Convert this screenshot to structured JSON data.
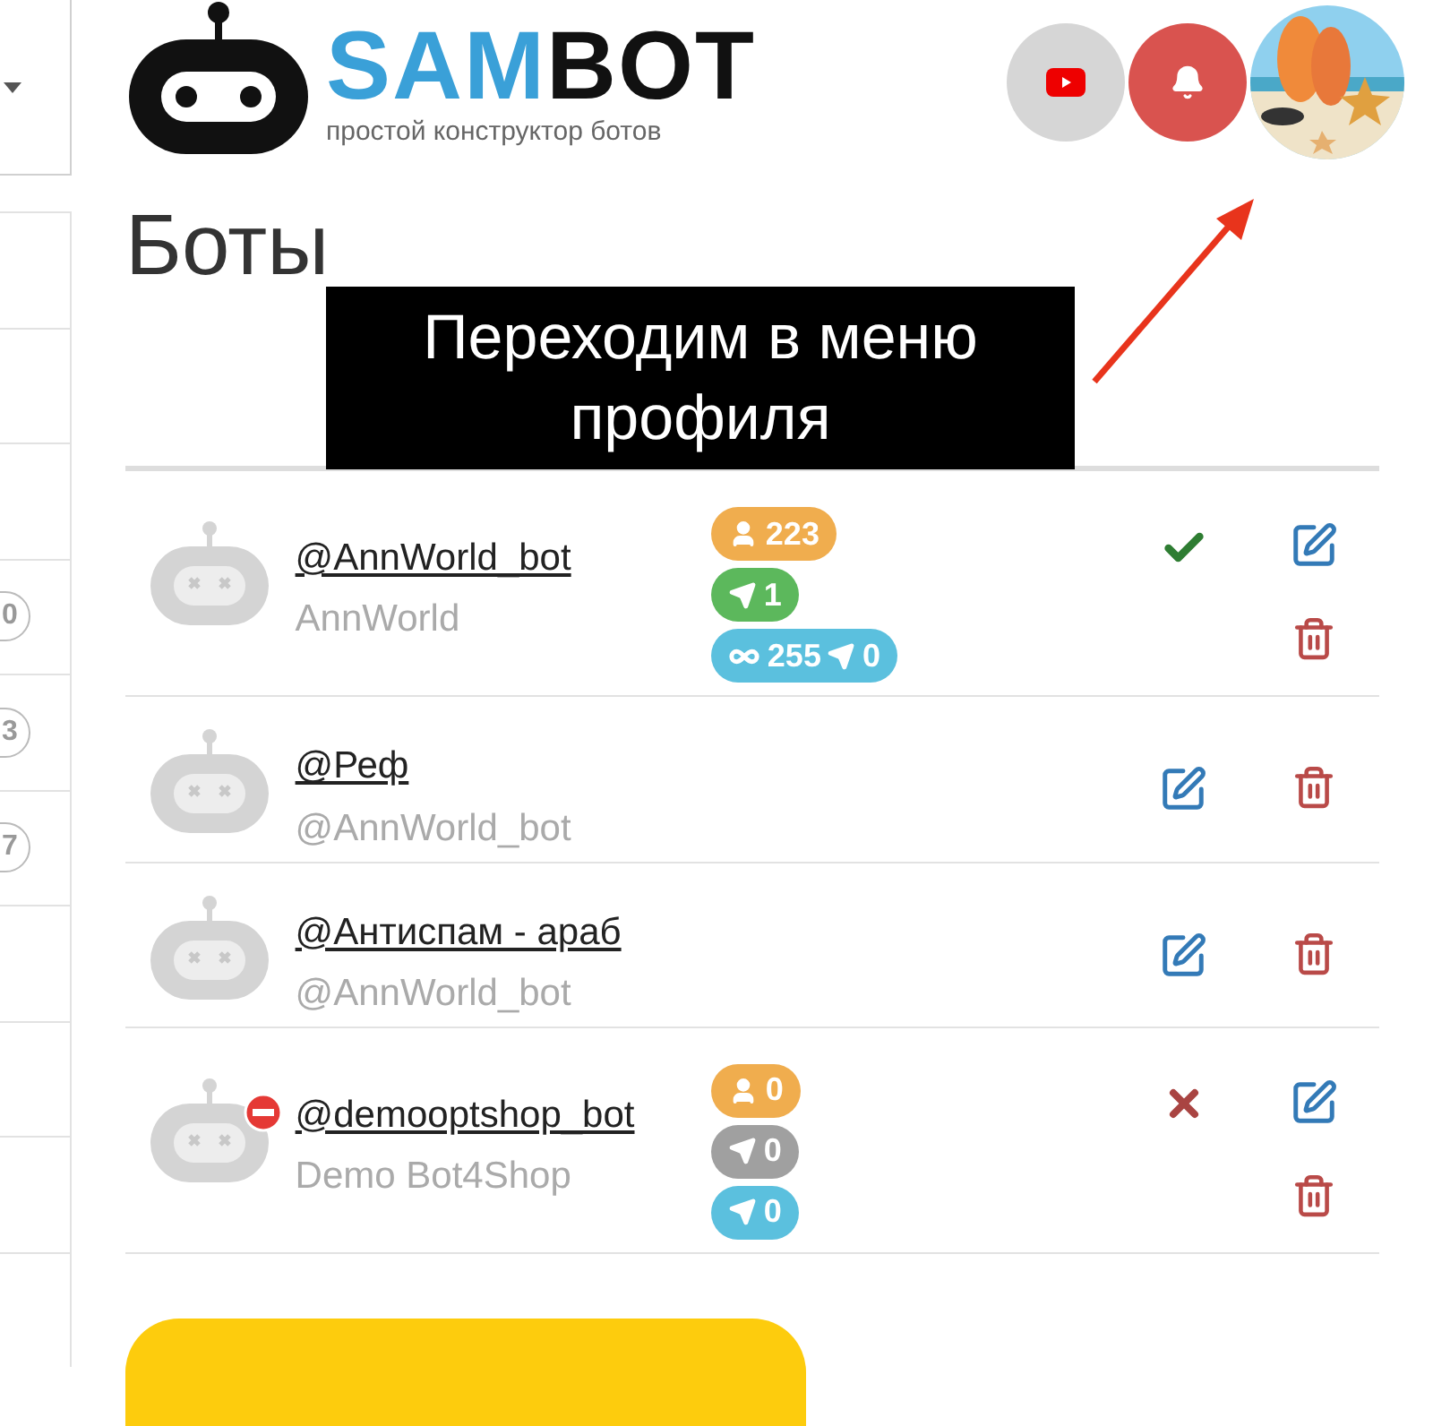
{
  "logo": {
    "brand_part_1": "SAM",
    "brand_part_2": "BOT",
    "tagline": "простой конструктор ботов"
  },
  "header_buttons": [
    {
      "kind": "youtube"
    },
    {
      "kind": "bell"
    }
  ],
  "sidebar": {
    "rows": [
      {},
      {},
      {},
      {
        "badge": "0"
      },
      {
        "badge": "3"
      },
      {
        "badge": "7"
      },
      {},
      {},
      {},
      {}
    ]
  },
  "page_title": "Боты",
  "callout": {
    "text": "Переходим в меню профиля"
  },
  "bots": [
    {
      "name": "@AnnWorld_bot",
      "subtitle": "AnnWorld",
      "blocked": false,
      "kind": "running",
      "badges": [
        {
          "color": "#f0ad4e",
          "parts": [
            {
              "kind": "users",
              "text": "223"
            }
          ]
        },
        {
          "color": "#5cb85c",
          "parts": [
            {
              "kind": "sent",
              "text": "1"
            }
          ]
        },
        {
          "color": "#5bc0de",
          "parts": [
            {
              "kind": "unlimited",
              "text": "255"
            },
            {
              "kind": "sent",
              "text": "0"
            }
          ]
        }
      ]
    },
    {
      "name": "@Реф",
      "subtitle": "@AnnWorld_bot",
      "blocked": false,
      "kind": "plain"
    },
    {
      "name": "@Антиспам - араб",
      "subtitle": "@AnnWorld_bot",
      "blocked": false,
      "kind": "plain"
    },
    {
      "name": "@demooptshop_bot",
      "subtitle": "Demo Bot4Shop",
      "blocked": true,
      "kind": "stopped",
      "badges": [
        {
          "color": "#f0ad4e",
          "parts": [
            {
              "kind": "users",
              "text": "0"
            }
          ]
        },
        {
          "color": "#a0a0a0",
          "parts": [
            {
              "kind": "sent",
              "text": "0"
            }
          ]
        },
        {
          "color": "#5bc0de",
          "parts": [
            {
              "kind": "sent",
              "text": "0"
            }
          ]
        }
      ]
    }
  ]
}
